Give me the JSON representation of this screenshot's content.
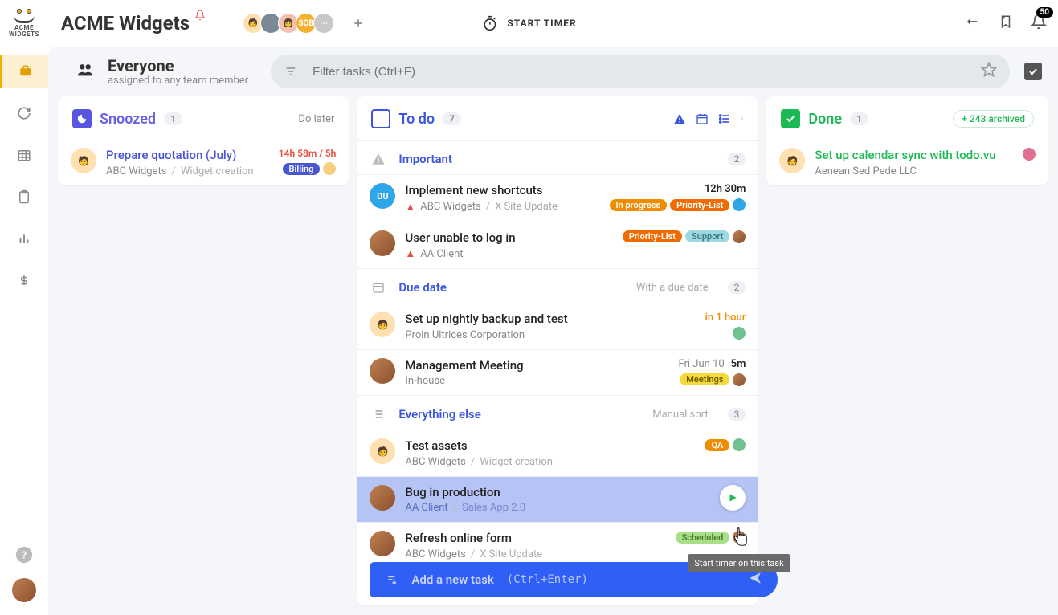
{
  "logo": {
    "line1": "ACME",
    "line2": "WIDGETS"
  },
  "workspace": "ACME Widgets",
  "timer_label": "START TIMER",
  "notif_count": "50",
  "header": {
    "title": "Everyone",
    "subtitle": "assigned to any team member"
  },
  "search": {
    "placeholder": "Filter tasks (Ctrl+F)"
  },
  "columns": {
    "snoozed": {
      "title": "Snoozed",
      "count": "1",
      "hint": "Do later"
    },
    "todo": {
      "title": "To do",
      "count": "7"
    },
    "done": {
      "title": "Done",
      "count": "1",
      "archived": "+ 243 archived"
    }
  },
  "snoozed_tasks": [
    {
      "title": "Prepare quotation (July)",
      "client": "ABC Widgets",
      "project": "Widget creation",
      "time": "14h 58m / 5h",
      "tag": "Billing"
    }
  ],
  "done_tasks": [
    {
      "title": "Set up calendar sync with todo.vu",
      "client": "Aenean Sed Pede LLC"
    }
  ],
  "sections": {
    "important": {
      "title": "Important",
      "count": "2"
    },
    "due": {
      "title": "Due date",
      "hint": "With a due date",
      "count": "2"
    },
    "else": {
      "title": "Everything else",
      "hint": "Manual sort",
      "count": "3"
    }
  },
  "todo": {
    "important": [
      {
        "title": "Implement new shortcuts",
        "client": "ABC Widgets",
        "project": "X Site Update",
        "time": "12h 30m",
        "tags": [
          "In progress",
          "Priority-List"
        ],
        "av": "DU",
        "warn": true
      },
      {
        "title": "User unable to log in",
        "client": "AA Client",
        "tags": [
          "Priority-List",
          "Support"
        ],
        "warn": true
      }
    ],
    "due": [
      {
        "title": "Set up nightly backup and test",
        "client": "Proin Ultrices Corporation",
        "time": "in 1 hour"
      },
      {
        "title": "Management Meeting",
        "client": "In-house",
        "date": "Fri Jun 10",
        "time": "5m",
        "tags": [
          "Meetings"
        ]
      }
    ],
    "else": [
      {
        "title": "Test assets",
        "client": "ABC Widgets",
        "project": "Widget creation",
        "tags": [
          "QA"
        ]
      },
      {
        "title": "Bug in production",
        "client": "AA Client",
        "project": "Sales App 2.0"
      },
      {
        "title": "Refresh online form",
        "client": "ABC Widgets",
        "project": "X Site Update",
        "tags": [
          "Scheduled"
        ]
      }
    ]
  },
  "tooltip": "Start timer on this task",
  "add_task": {
    "label": "Add a new task",
    "hint": "(Ctrl+Enter)"
  }
}
